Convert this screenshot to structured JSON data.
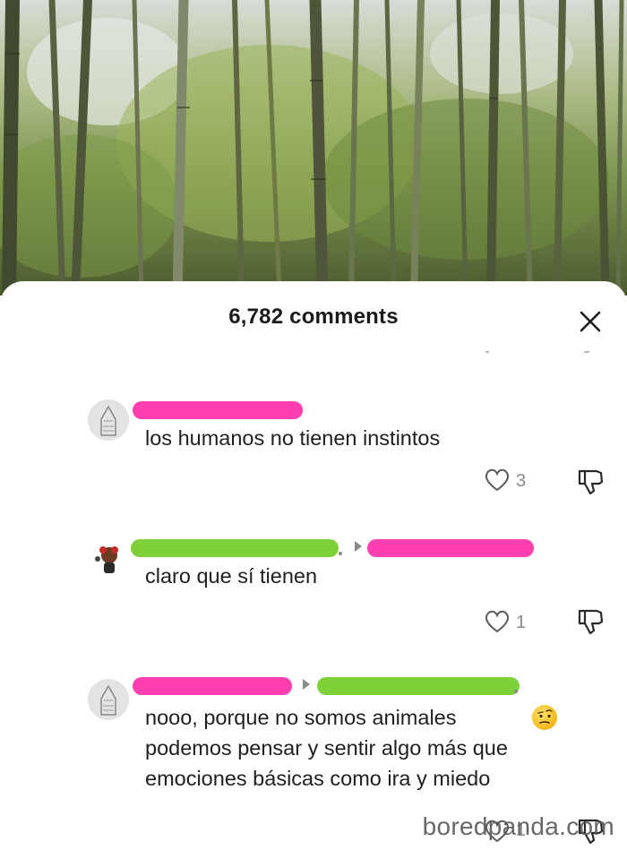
{
  "sheet": {
    "title": "6,782 comments",
    "close_icon": "close-icon"
  },
  "comments": [
    {
      "avatar_icon": "hooded-figure-avatar",
      "author_redacted_color": "#ff3fb0",
      "text_lines": [
        "los humanos no tienen instintos"
      ],
      "likes": "3"
    },
    {
      "avatar_icon": "cartoon-character-avatar",
      "author_redacted_color": "#7fd13a",
      "reply_to_redacted_color": "#ff3fb0",
      "text_lines": [
        "claro que sí tienen"
      ],
      "likes": "1"
    },
    {
      "avatar_icon": "hooded-figure-avatar",
      "author_redacted_color": "#ff3fb0",
      "reply_to_redacted_color": "#7fd13a",
      "text_lines": [
        "nooo, porque no somos animales",
        "podemos pensar y sentir algo más que",
        "emociones básicas como ira y miedo"
      ],
      "emoji_icon": "raised-eyebrow-face-emoji",
      "likes": "1"
    }
  ],
  "watermark": "boredpanda.com",
  "colors": {
    "redact_pink": "#ff3fb0",
    "redact_green": "#7fd13a",
    "text": "#1f1f1f",
    "muted": "#8a8a8a"
  }
}
